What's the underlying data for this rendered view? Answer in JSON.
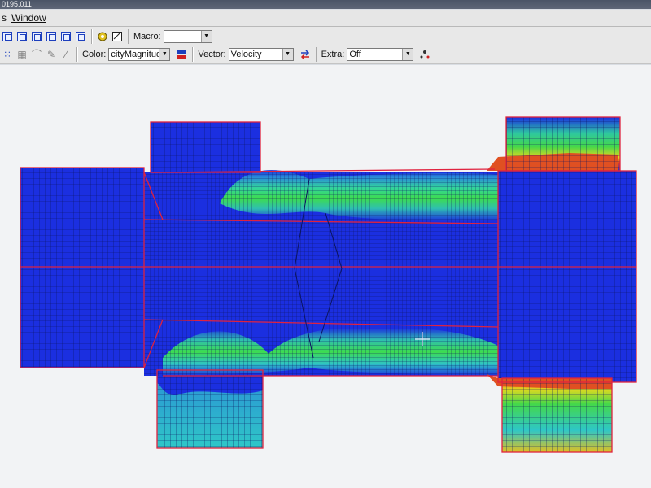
{
  "window": {
    "title_fragment": "0195.011"
  },
  "menu": {
    "items": [
      "s",
      "Window"
    ]
  },
  "toolbar_top": {
    "macro_label": "Macro:",
    "macro_value": ""
  },
  "toolbar_display": {
    "color_label": "Color:",
    "color_value": "cityMagnitude",
    "vector_label": "Vector:",
    "vector_value": "Velocity",
    "extra_label": "Extra:",
    "extra_value": "Off"
  },
  "icons": {
    "view_cubes": [
      "view-iso-icon",
      "view-front-icon",
      "view-back-icon",
      "view-left-icon",
      "view-right-icon",
      "view-top-icon",
      "view-bottom-icon"
    ],
    "tools": [
      "nodes-icon",
      "grid-icon",
      "curve-icon",
      "pen-icon",
      "brush-icon"
    ]
  },
  "colors": {
    "mesh_blue": "#1b2fe0",
    "cyan": "#28b6d8",
    "green": "#2fd35a",
    "yellow": "#e3e020",
    "red_line": "#e0223f",
    "grid_line": "#0b1460"
  }
}
